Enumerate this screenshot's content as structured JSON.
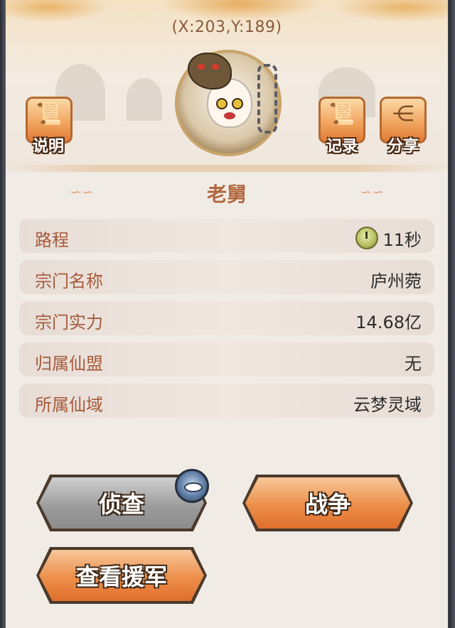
{
  "coords": "(X:203,Y:189)",
  "toolbar": {
    "help_label": "说明",
    "record_label": "记录",
    "share_label": "分享"
  },
  "target": {
    "name": "老舅"
  },
  "info_rows": [
    {
      "key": "路程",
      "value": "11秒",
      "icon": "clock-icon"
    },
    {
      "key": "宗门名称",
      "value": "庐州菀"
    },
    {
      "key": "宗门实力",
      "value": "14.68亿"
    },
    {
      "key": "归属仙盟",
      "value": "无"
    },
    {
      "key": "所属仙域",
      "value": "云梦灵域"
    }
  ],
  "actions": {
    "scout_label": "侦查",
    "war_label": "战争",
    "reinforce_label": "查看援军"
  },
  "colors": {
    "key_text": "#a65a3a",
    "name_text": "#b0683e",
    "button_orange": "#ec8f4a",
    "button_gray": "#9a9a9a"
  }
}
